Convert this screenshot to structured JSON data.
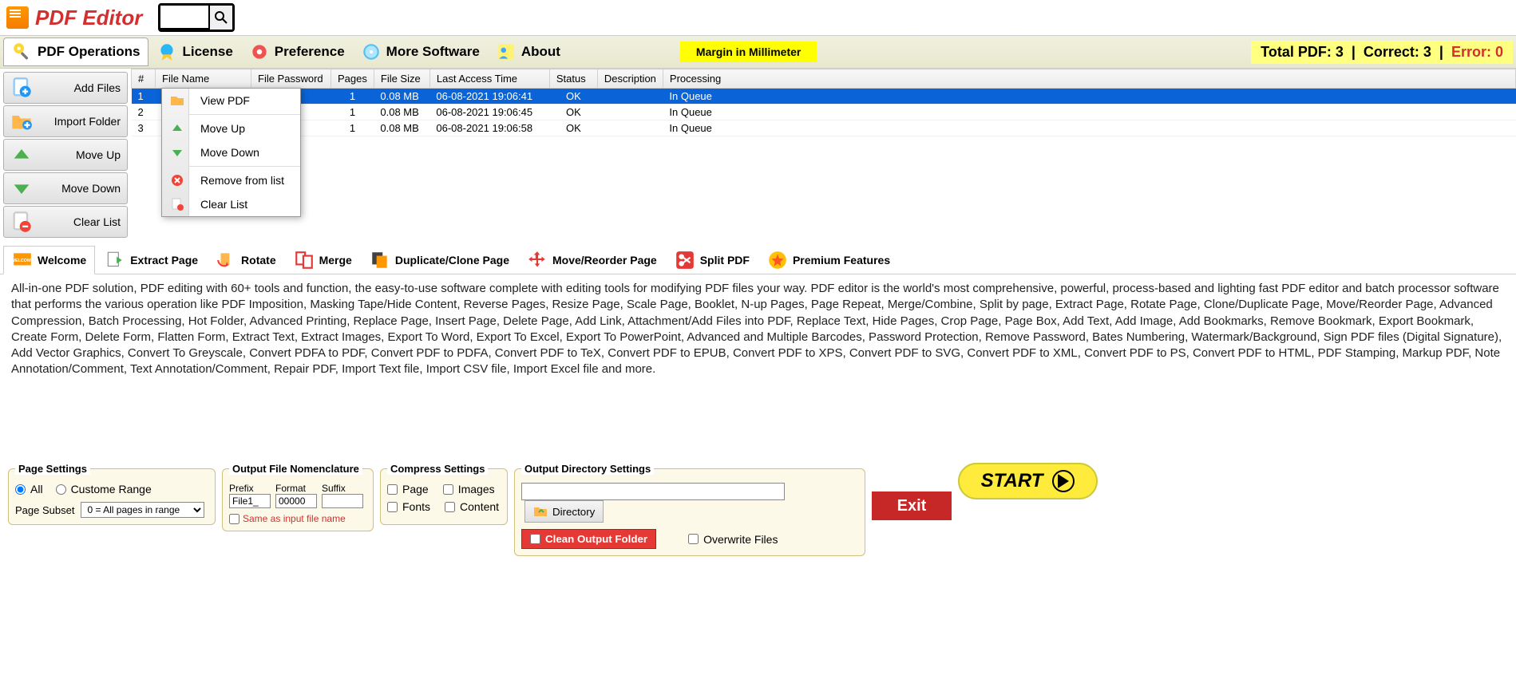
{
  "app": {
    "title": "PDF Editor"
  },
  "menu": {
    "items": [
      "PDF Operations",
      "License",
      "Preference",
      "More Software",
      "About"
    ],
    "badge": "Margin in Millimeter",
    "stats": {
      "total_label": "Total PDF: 3",
      "correct_label": "Correct: 3",
      "error_label": "Error: 0"
    }
  },
  "sidebar": [
    "Add Files",
    "Import Folder",
    "Move Up",
    "Move Down",
    "Clear List"
  ],
  "grid": {
    "cols": [
      "#",
      "File Name",
      "File Password",
      "Pages",
      "File Size",
      "Last Access Time",
      "Status",
      "Description",
      "Processing"
    ],
    "rows": [
      {
        "n": "1",
        "fn": "",
        "pw": "",
        "pg": "1",
        "sz": "0.08 MB",
        "ts": "06-08-2021 19:06:41",
        "st": "OK",
        "de": "",
        "pr": "In Queue"
      },
      {
        "n": "2",
        "fn": "",
        "pw": "",
        "pg": "1",
        "sz": "0.08 MB",
        "ts": "06-08-2021 19:06:45",
        "st": "OK",
        "de": "",
        "pr": "In Queue"
      },
      {
        "n": "3",
        "fn": "",
        "pw": "",
        "pg": "1",
        "sz": "0.08 MB",
        "ts": "06-08-2021 19:06:58",
        "st": "OK",
        "de": "",
        "pr": "In Queue"
      }
    ]
  },
  "ctx": [
    "View PDF",
    "Move Up",
    "Move Down",
    "Remove from list",
    "Clear List"
  ],
  "tabs": [
    "Welcome",
    "Extract Page",
    "Rotate",
    "Merge",
    "Duplicate/Clone Page",
    "Move/Reorder Page",
    "Split PDF",
    "Premium Features"
  ],
  "welcome_text": "All-in-one PDF solution, PDF editing with 60+ tools and function, the easy-to-use software complete with editing tools for modifying PDF files your way. PDF editor is the world's most comprehensive, powerful, process-based and lighting fast PDF editor and batch processor software that performs the various operation like PDF Imposition, Masking Tape/Hide Content, Reverse Pages, Resize Page, Scale Page, Booklet, N-up Pages, Page Repeat, Merge/Combine, Split by page, Extract Page, Rotate Page, Clone/Duplicate Page, Move/Reorder Page, Advanced Compression, Batch Processing, Hot Folder, Advanced Printing, Replace Page, Insert Page, Delete Page, Add Link, Attachment/Add Files into PDF, Replace Text, Hide Pages, Crop Page, Page Box, Add Text, Add Image, Add Bookmarks, Remove Bookmark, Export Bookmark, Create Form, Delete Form, Flatten Form, Extract Text, Extract Images, Export To Word, Export To Excel, Export To PowerPoint, Advanced and Multiple Barcodes, Password Protection, Remove Password, Bates Numbering,  Watermark/Background, Sign PDF files (Digital Signature), Add Vector Graphics, Convert To Greyscale, Convert PDFA to PDF, Convert PDF to PDFA, Convert PDF to TeX, Convert PDF to EPUB, Convert PDF to XPS, Convert PDF to SVG, Convert PDF to XML, Convert PDF to PS, Convert PDF to HTML, PDF Stamping, Markup PDF, Note Annotation/Comment, Text Annotation/Comment, Repair PDF, Import Text file, Import CSV file, Import Excel file and more.",
  "page_settings": {
    "title": "Page Settings",
    "all": "All",
    "custom": "Custome Range",
    "subset_label": "Page Subset",
    "subset_value": "0 = All pages in range"
  },
  "nom": {
    "title": "Output File Nomenclature",
    "prefix": "Prefix",
    "format": "Format",
    "suffix": "Suffix",
    "prefix_val": "File1_",
    "format_val": "00000",
    "suffix_val": "",
    "same": "Same as input file name"
  },
  "compress": {
    "title": "Compress Settings",
    "page": "Page",
    "images": "Images",
    "fonts": "Fonts",
    "content": "Content"
  },
  "outdir": {
    "title": "Output Directory Settings",
    "directory": "Directory",
    "clean": "Clean Output Folder",
    "overwrite": "Overwrite Files"
  },
  "exit": "Exit",
  "start": "START"
}
